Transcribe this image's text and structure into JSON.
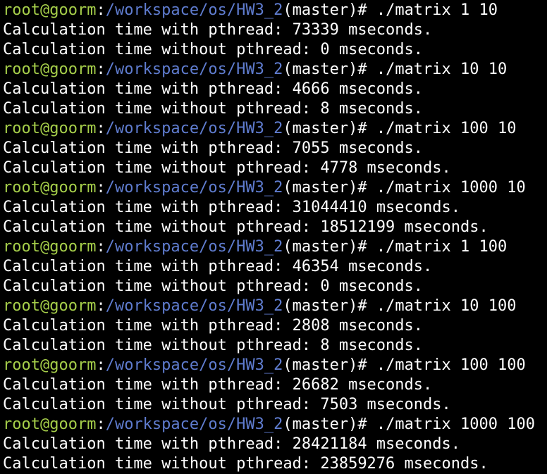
{
  "colors": {
    "background": "#000000",
    "text": "#ffffff",
    "user_host": "#a6cf4a",
    "path": "#5f7ccf"
  },
  "prompt": {
    "user_host": "root@goorm",
    "separator": ":",
    "path": "/workspace/os/HW3_2",
    "branch": "(master)# "
  },
  "commands": [
    {
      "command": "./matrix 1 10",
      "with_pthread": "Calculation time with pthread: 73339 mseconds.",
      "without_pthread": "Calculation time without pthread: 0 mseconds."
    },
    {
      "command": "./matrix 10 10",
      "with_pthread": "Calculation time with pthread: 4666 mseconds.",
      "without_pthread": "Calculation time without pthread: 8 mseconds."
    },
    {
      "command": "./matrix 100 10",
      "with_pthread": "Calculation time with pthread: 7055 mseconds.",
      "without_pthread": "Calculation time without pthread: 4778 mseconds."
    },
    {
      "command": "./matrix 1000 10",
      "with_pthread": "Calculation time with pthread: 31044410 mseconds.",
      "without_pthread": "Calculation time without pthread: 18512199 mseconds."
    },
    {
      "command": "./matrix 1 100",
      "with_pthread": "Calculation time with pthread: 46354 mseconds.",
      "without_pthread": "Calculation time without pthread: 0 mseconds."
    },
    {
      "command": "./matrix 10 100",
      "with_pthread": "Calculation time with pthread: 2808 mseconds.",
      "without_pthread": "Calculation time without pthread: 8 mseconds."
    },
    {
      "command": "./matrix 100 100",
      "with_pthread": "Calculation time with pthread: 26682 mseconds.",
      "without_pthread": "Calculation time without pthread: 7503 mseconds."
    },
    {
      "command": "./matrix 1000 100",
      "with_pthread": "Calculation time with pthread: 28421184 mseconds.",
      "without_pthread": "Calculation time without pthread: 23859276 mseconds."
    }
  ]
}
